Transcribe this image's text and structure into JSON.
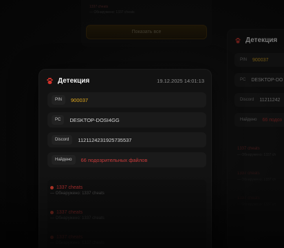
{
  "background_top_card": {
    "line1": "1337 cheats",
    "line2": "— Обнаружено: 1337 cheats",
    "show_all_label": "Показать все"
  },
  "main_card": {
    "title": "Детекция",
    "datetime": "19.12.2025 14:01:13",
    "rows": [
      {
        "key": "PIN",
        "value": "900037"
      },
      {
        "key": "PC",
        "value": "DESKTOP-DOSI4GG"
      },
      {
        "key": "Discord",
        "value": "1121124231925735537"
      },
      {
        "key": "Найдено",
        "value": "66 подозрительных файлов"
      }
    ],
    "items": [
      {
        "name": "1337 cheats",
        "detail": "— Обнаружено: 1337 cheats"
      },
      {
        "name": "1337 cheats",
        "detail": "— Обнаружено: 1337 cheats"
      },
      {
        "name": "1337 cheats",
        "detail": "— Обнаружено: 1337 cheats"
      }
    ]
  },
  "right_card": {
    "title": "Детекция",
    "rows": [
      {
        "key": "PIN",
        "value": "900037"
      },
      {
        "key": "PC",
        "value": "DESKTOP-DO"
      },
      {
        "key": "Discord",
        "value": "11211242"
      },
      {
        "key": "Найдено",
        "value": "66 подоз"
      }
    ],
    "items": [
      {
        "name": "1337 cheats",
        "detail": "— Обнаружено: 1337 ch"
      },
      {
        "name": "1337 cheats",
        "detail": "— Обнаружено: 1337 ch"
      },
      {
        "name": "1337 cheats",
        "detail": "— Обнаружено: 1337 ch"
      }
    ]
  },
  "colors": {
    "accent_gold": "#e0a81e",
    "alert_red": "#c93a3a",
    "paw_red": "#d4322b"
  }
}
